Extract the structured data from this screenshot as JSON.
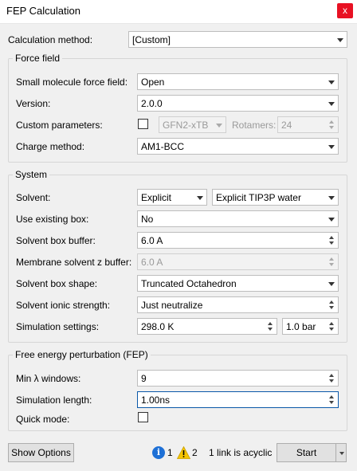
{
  "window": {
    "title": "FEP Calculation",
    "close_label": "x"
  },
  "calculation_method": {
    "label": "Calculation method:",
    "value": "[Custom]"
  },
  "force_field": {
    "title": "Force field",
    "small_molecule_ff": {
      "label": "Small molecule force field:",
      "value": "Open"
    },
    "version": {
      "label": "Version:",
      "value": "2.0.0"
    },
    "custom_parameters": {
      "label": "Custom parameters:",
      "checked": false,
      "method": "GFN2-xTB",
      "rotamers_label": "Rotamers:",
      "rotamers_value": "24"
    },
    "charge_method": {
      "label": "Charge method:",
      "value": "AM1-BCC"
    }
  },
  "system": {
    "title": "System",
    "solvent": {
      "label": "Solvent:",
      "type": "Explicit",
      "model": "Explicit TIP3P water"
    },
    "use_existing_box": {
      "label": "Use existing box:",
      "value": "No"
    },
    "solvent_box_buffer": {
      "label": "Solvent box buffer:",
      "value": "6.0 A"
    },
    "membrane_buffer": {
      "label": "Membrane solvent z buffer:",
      "value": "6.0 A"
    },
    "box_shape": {
      "label": "Solvent box shape:",
      "value": "Truncated Octahedron"
    },
    "ionic_strength": {
      "label": "Solvent ionic strength:",
      "value": "Just neutralize"
    },
    "simulation_settings": {
      "label": "Simulation settings:",
      "temperature": "298.0 K",
      "pressure": "1.0 bar"
    }
  },
  "fep": {
    "title": "Free energy perturbation (FEP)",
    "min_lambda": {
      "label": "Min λ windows:",
      "value": "9"
    },
    "sim_length": {
      "label": "Simulation length:",
      "value": "1.00ns"
    },
    "quick_mode": {
      "label": "Quick mode:",
      "checked": false
    }
  },
  "footer": {
    "show_options_label": "Show Options",
    "info_count": "1",
    "warning_count": "2",
    "status_message": "1 link is acyclic",
    "start_label": "Start"
  },
  "colors": {
    "close": "#e81123",
    "info": "#1e70d6",
    "warning": "#f5c400",
    "focus": "#0a58a8"
  },
  "icons": {
    "info": "info-icon",
    "warning": "warning-icon",
    "close": "close-icon",
    "dropdown": "chevron-down-icon"
  }
}
